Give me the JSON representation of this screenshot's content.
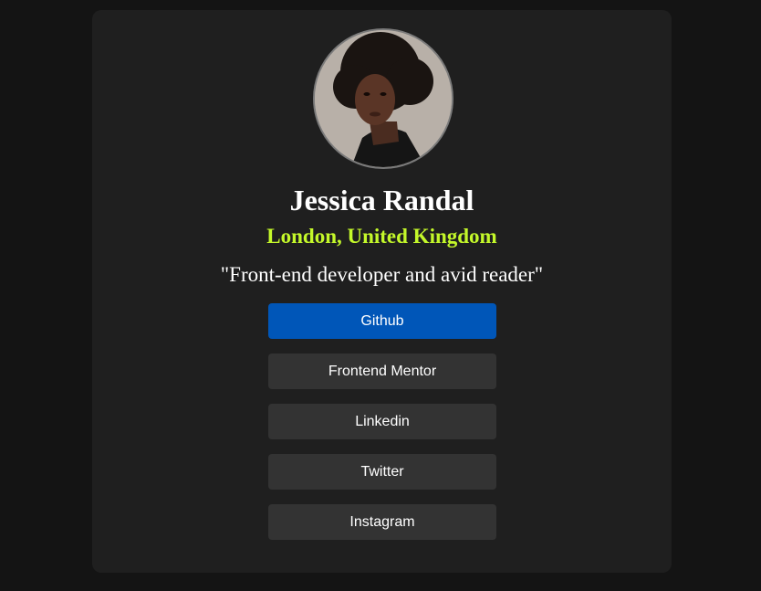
{
  "profile": {
    "name": "Jessica Randal",
    "location": "London, United Kingdom",
    "bio": "\"Front-end developer and avid reader\""
  },
  "links": [
    {
      "label": "Github"
    },
    {
      "label": "Frontend Mentor"
    },
    {
      "label": "Linkedin"
    },
    {
      "label": "Twitter"
    },
    {
      "label": "Instagram"
    }
  ],
  "colors": {
    "page_background": "#141414",
    "card_background": "#1f1f1f",
    "accent": "#c4f82a",
    "button_background": "#333333",
    "button_active": "#0056b8"
  }
}
